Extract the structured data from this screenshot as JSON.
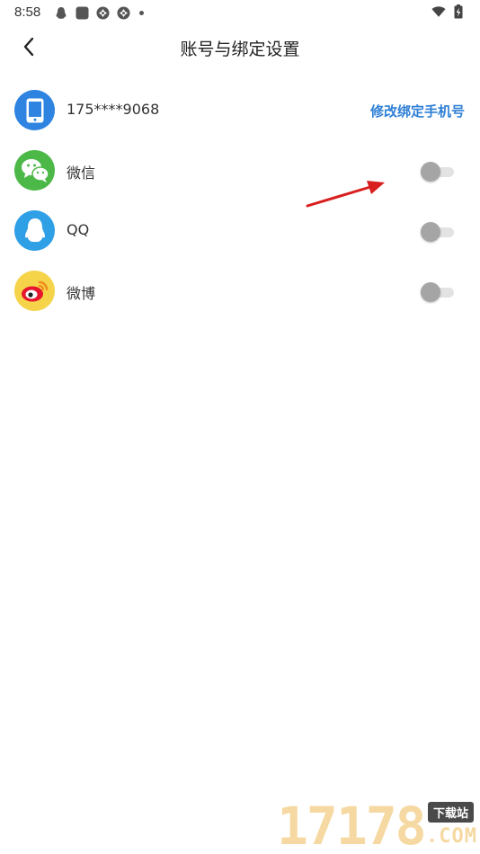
{
  "status_bar": {
    "time": "8:58",
    "icons_left": [
      "qq-penguin-icon",
      "square-app-icon",
      "aperture-icon",
      "aperture-icon",
      "notification-dot-icon"
    ],
    "icons_right": [
      "wifi-icon",
      "battery-charging-icon"
    ]
  },
  "header": {
    "back_icon": "chevron-left-icon",
    "title": "账号与绑定设置"
  },
  "bindings": [
    {
      "id": "phone",
      "icon": "phone-icon",
      "label": "175****9068",
      "action": "修改绑定手机号",
      "color": "#2e84e0"
    },
    {
      "id": "wechat",
      "icon": "wechat-icon",
      "label": "微信",
      "bound": false,
      "color": "#4cb848"
    },
    {
      "id": "qq",
      "icon": "qq-icon",
      "label": "QQ",
      "bound": false,
      "color": "#2f9fe6"
    },
    {
      "id": "weibo",
      "icon": "weibo-icon",
      "label": "微博",
      "bound": false,
      "color": "#f5d44a"
    }
  ],
  "watermark": {
    "digits": "17178",
    "tag": "下载站",
    "suffix": ".COM"
  },
  "colors": {
    "accent": "#2f7fd6",
    "toggle_off_thumb": "#a5a5a5",
    "toggle_off_track": "#e3e3e3",
    "annotation_arrow": "#d81e1e"
  }
}
